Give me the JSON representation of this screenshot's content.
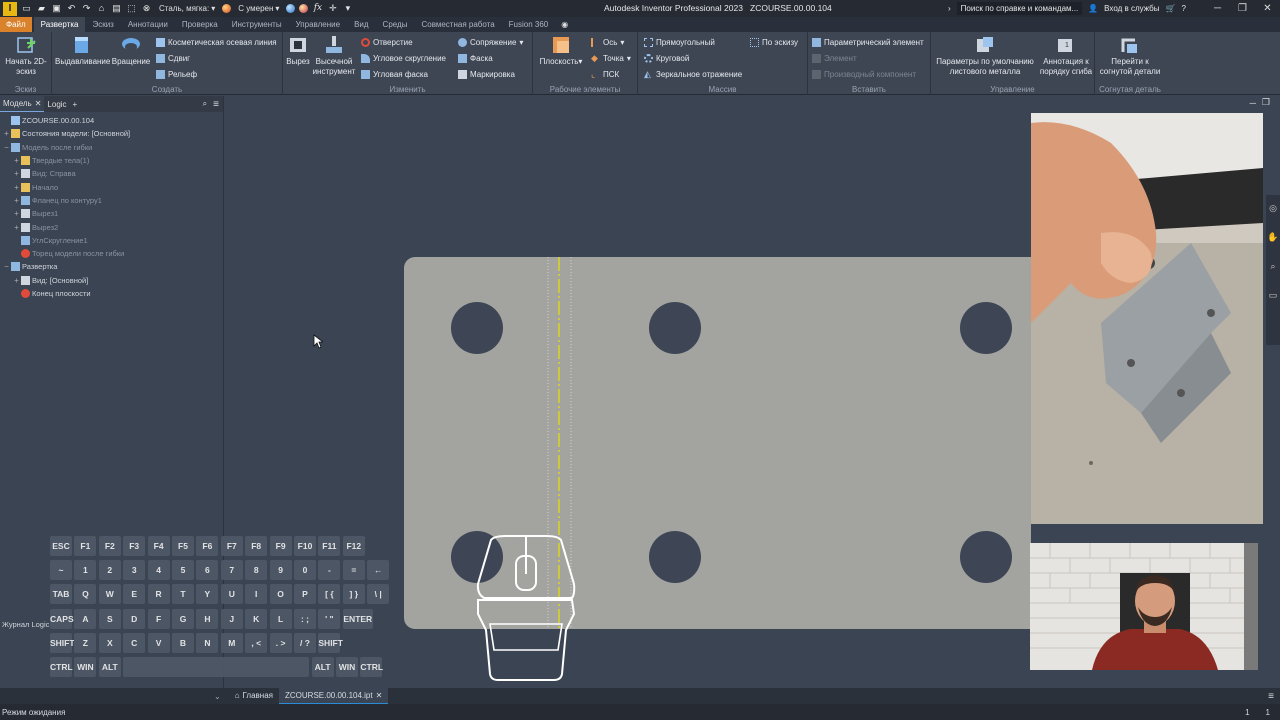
{
  "app": {
    "title": "Autodesk Inventor Professional 2023",
    "document": "ZCOURSE.00.00.104",
    "logo_letter": "I"
  },
  "quick_access": {
    "material": "Сталь, мягка:",
    "appearance": "С умерен",
    "fx": "fx"
  },
  "search": {
    "placeholder": "Поиск по справке и командам...",
    "sign_in": "Вход в службы",
    "help": "?"
  },
  "tabs": [
    "Файл",
    "Развертка",
    "Эскиз",
    "Аннотации",
    "Проверка",
    "Инструменты",
    "Управление",
    "Вид",
    "Среды",
    "Совместная работа",
    "Fusion 360"
  ],
  "active_tab": "Развертка",
  "ribbon": {
    "sketch": {
      "label": "Эскиз",
      "start": "Начать 2D-эскиз"
    },
    "create": {
      "label": "Создать",
      "extrude": "Выдавливание",
      "revolve": "Вращение",
      "cosmetic": "Косметическая осевая линия",
      "shift": "Сдвиг",
      "emboss": "Рельеф"
    },
    "modify": {
      "label": "Изменить",
      "cut": "Вырез",
      "punch": "Высечной инструмент",
      "hole": "Отверстие",
      "corner_round": "Угловое скругление",
      "corner_chamfer": "Угловая фаска",
      "fillet": "Сопряжение",
      "chamfer": "Фаска",
      "mark": "Маркировка"
    },
    "work": {
      "label": "Рабочие элементы",
      "plane": "Плоскость",
      "axis": "Ось",
      "point": "Точка",
      "ucs": "ПСК"
    },
    "pattern": {
      "label": "Массив",
      "rect": "Прямоугольный",
      "circ": "Круговой",
      "mirror": "Зеркальное отражение",
      "sketch_driven": "По эскизу"
    },
    "insert": {
      "label": "Вставить",
      "ifeature": "Параметрический элемент",
      "element": "Элемент",
      "derive": "Производный компонент"
    },
    "manage": {
      "label": "Управление",
      "defaults": "Параметры по умолчанию листового металла",
      "bend_order": "Аннотация к порядку сгиба"
    },
    "folded": {
      "label": "Согнутая деталь",
      "go_folded": "Перейти к согнутой детали"
    }
  },
  "browser": {
    "tab_model": "Модель",
    "tab_logic": "Logic",
    "add": "+",
    "tree": [
      {
        "label": "ZCOURSE.00.00.104",
        "level": 0,
        "exp": "",
        "icon": "part-icon",
        "dim": false
      },
      {
        "label": "Состояния модели: [Основной]",
        "level": 0,
        "exp": "+",
        "icon": "folder-icon",
        "dim": false
      },
      {
        "label": "Модель после гибки",
        "level": 0,
        "exp": "−",
        "icon": "sheetmetal-icon",
        "dim": true
      },
      {
        "label": "Твердые тела(1)",
        "level": 1,
        "exp": "+",
        "icon": "folder-icon",
        "dim": true
      },
      {
        "label": "Вид: Справа",
        "level": 1,
        "exp": "+",
        "icon": "view-icon",
        "dim": true
      },
      {
        "label": "Начало",
        "level": 1,
        "exp": "+",
        "icon": "folder-icon",
        "dim": true
      },
      {
        "label": "Фланец по контуру1",
        "level": 1,
        "exp": "+",
        "icon": "flange-icon",
        "dim": true
      },
      {
        "label": "Вырез1",
        "level": 1,
        "exp": "+",
        "icon": "cut-icon",
        "dim": true
      },
      {
        "label": "Вырез2",
        "level": 1,
        "exp": "+",
        "icon": "cut-icon",
        "dim": true
      },
      {
        "label": "УглСкругление1",
        "level": 1,
        "exp": "",
        "icon": "round-icon",
        "dim": true
      },
      {
        "label": "Торец модели после гибки",
        "level": 1,
        "exp": "",
        "icon": "end-icon",
        "dim": true
      },
      {
        "label": "Развертка",
        "level": 0,
        "exp": "−",
        "icon": "flat-icon",
        "dim": false
      },
      {
        "label": "Вид: [Основной]",
        "level": 1,
        "exp": "+",
        "icon": "view-icon",
        "dim": false
      },
      {
        "label": "Конец плоскости",
        "level": 1,
        "exp": "",
        "icon": "end-icon",
        "dim": false
      }
    ]
  },
  "journal": "Журнал Logic",
  "keyboard": {
    "rows": [
      [
        "ESC",
        "F1",
        "F2",
        "F3",
        "F4",
        "F5",
        "F6",
        "F7",
        "F8",
        "F9",
        "F10",
        "F11",
        "F12"
      ],
      [
        "~",
        "1",
        "2",
        "3",
        "4",
        "5",
        "6",
        "7",
        "8",
        "9",
        "0",
        "-",
        "=",
        "←"
      ],
      [
        "TAB",
        "Q",
        "W",
        "E",
        "R",
        "T",
        "Y",
        "U",
        "I",
        "O",
        "P",
        "[ {",
        "] }",
        "\\ |"
      ],
      [
        "CAPS",
        "A",
        "S",
        "D",
        "F",
        "G",
        "H",
        "J",
        "K",
        "L",
        ": ;",
        "' \"",
        "ENTER"
      ],
      [
        "SHIFT",
        "Z",
        "X",
        "C",
        "V",
        "B",
        "N",
        "M",
        ", <",
        ". >",
        "/ ?",
        "SHIFT"
      ],
      [
        "CTRL",
        "WIN",
        "ALT",
        "",
        "ALT",
        "WIN",
        "CTRL"
      ]
    ]
  },
  "doc_tabs": {
    "home": "Главная",
    "file": "ZCOURSE.00.00.104.ipt"
  },
  "status": {
    "text": "Режим ожидания",
    "count1": "1",
    "count2": "1"
  },
  "colors": {
    "accent_tab": "#d9822b",
    "plate": "#a3a3a0",
    "centerline": "#e8e200",
    "background": "#3b4453"
  }
}
